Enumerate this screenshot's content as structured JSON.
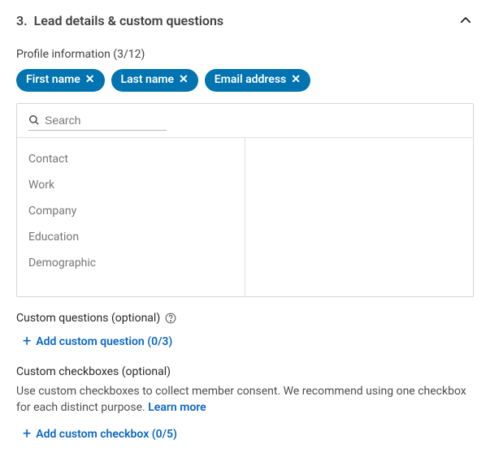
{
  "section": {
    "number": "3.",
    "title": "Lead details & custom questions"
  },
  "profile_info": {
    "label": "Profile information (3/12)",
    "chips": [
      {
        "label": "First name"
      },
      {
        "label": "Last name"
      },
      {
        "label": "Email address"
      }
    ],
    "search_placeholder": "Search",
    "categories": [
      {
        "label": "Contact"
      },
      {
        "label": "Work"
      },
      {
        "label": "Company"
      },
      {
        "label": "Education"
      },
      {
        "label": "Demographic"
      }
    ]
  },
  "custom_questions": {
    "label": "Custom questions (optional)",
    "add_label": "Add custom question (0/3)"
  },
  "custom_checkboxes": {
    "label": "Custom checkboxes (optional)",
    "description": "Use custom checkboxes to collect member consent. We recommend using one checkbox for each distinct purpose. ",
    "learn_more": "Learn more",
    "add_label": "Add custom checkbox (0/5)"
  }
}
